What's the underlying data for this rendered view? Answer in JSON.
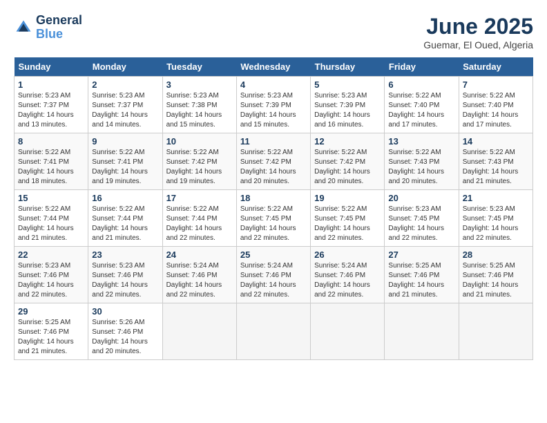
{
  "header": {
    "logo_line1": "General",
    "logo_line2": "Blue",
    "month": "June 2025",
    "location": "Guemar, El Oued, Algeria"
  },
  "days_of_week": [
    "Sunday",
    "Monday",
    "Tuesday",
    "Wednesday",
    "Thursday",
    "Friday",
    "Saturday"
  ],
  "weeks": [
    [
      {
        "day": "1",
        "info": "Sunrise: 5:23 AM\nSunset: 7:37 PM\nDaylight: 14 hours\nand 13 minutes."
      },
      {
        "day": "2",
        "info": "Sunrise: 5:23 AM\nSunset: 7:37 PM\nDaylight: 14 hours\nand 14 minutes."
      },
      {
        "day": "3",
        "info": "Sunrise: 5:23 AM\nSunset: 7:38 PM\nDaylight: 14 hours\nand 15 minutes."
      },
      {
        "day": "4",
        "info": "Sunrise: 5:23 AM\nSunset: 7:39 PM\nDaylight: 14 hours\nand 15 minutes."
      },
      {
        "day": "5",
        "info": "Sunrise: 5:23 AM\nSunset: 7:39 PM\nDaylight: 14 hours\nand 16 minutes."
      },
      {
        "day": "6",
        "info": "Sunrise: 5:22 AM\nSunset: 7:40 PM\nDaylight: 14 hours\nand 17 minutes."
      },
      {
        "day": "7",
        "info": "Sunrise: 5:22 AM\nSunset: 7:40 PM\nDaylight: 14 hours\nand 17 minutes."
      }
    ],
    [
      {
        "day": "8",
        "info": "Sunrise: 5:22 AM\nSunset: 7:41 PM\nDaylight: 14 hours\nand 18 minutes."
      },
      {
        "day": "9",
        "info": "Sunrise: 5:22 AM\nSunset: 7:41 PM\nDaylight: 14 hours\nand 19 minutes."
      },
      {
        "day": "10",
        "info": "Sunrise: 5:22 AM\nSunset: 7:42 PM\nDaylight: 14 hours\nand 19 minutes."
      },
      {
        "day": "11",
        "info": "Sunrise: 5:22 AM\nSunset: 7:42 PM\nDaylight: 14 hours\nand 20 minutes."
      },
      {
        "day": "12",
        "info": "Sunrise: 5:22 AM\nSunset: 7:42 PM\nDaylight: 14 hours\nand 20 minutes."
      },
      {
        "day": "13",
        "info": "Sunrise: 5:22 AM\nSunset: 7:43 PM\nDaylight: 14 hours\nand 20 minutes."
      },
      {
        "day": "14",
        "info": "Sunrise: 5:22 AM\nSunset: 7:43 PM\nDaylight: 14 hours\nand 21 minutes."
      }
    ],
    [
      {
        "day": "15",
        "info": "Sunrise: 5:22 AM\nSunset: 7:44 PM\nDaylight: 14 hours\nand 21 minutes."
      },
      {
        "day": "16",
        "info": "Sunrise: 5:22 AM\nSunset: 7:44 PM\nDaylight: 14 hours\nand 21 minutes."
      },
      {
        "day": "17",
        "info": "Sunrise: 5:22 AM\nSunset: 7:44 PM\nDaylight: 14 hours\nand 22 minutes."
      },
      {
        "day": "18",
        "info": "Sunrise: 5:22 AM\nSunset: 7:45 PM\nDaylight: 14 hours\nand 22 minutes."
      },
      {
        "day": "19",
        "info": "Sunrise: 5:22 AM\nSunset: 7:45 PM\nDaylight: 14 hours\nand 22 minutes."
      },
      {
        "day": "20",
        "info": "Sunrise: 5:23 AM\nSunset: 7:45 PM\nDaylight: 14 hours\nand 22 minutes."
      },
      {
        "day": "21",
        "info": "Sunrise: 5:23 AM\nSunset: 7:45 PM\nDaylight: 14 hours\nand 22 minutes."
      }
    ],
    [
      {
        "day": "22",
        "info": "Sunrise: 5:23 AM\nSunset: 7:46 PM\nDaylight: 14 hours\nand 22 minutes."
      },
      {
        "day": "23",
        "info": "Sunrise: 5:23 AM\nSunset: 7:46 PM\nDaylight: 14 hours\nand 22 minutes."
      },
      {
        "day": "24",
        "info": "Sunrise: 5:24 AM\nSunset: 7:46 PM\nDaylight: 14 hours\nand 22 minutes."
      },
      {
        "day": "25",
        "info": "Sunrise: 5:24 AM\nSunset: 7:46 PM\nDaylight: 14 hours\nand 22 minutes."
      },
      {
        "day": "26",
        "info": "Sunrise: 5:24 AM\nSunset: 7:46 PM\nDaylight: 14 hours\nand 22 minutes."
      },
      {
        "day": "27",
        "info": "Sunrise: 5:25 AM\nSunset: 7:46 PM\nDaylight: 14 hours\nand 21 minutes."
      },
      {
        "day": "28",
        "info": "Sunrise: 5:25 AM\nSunset: 7:46 PM\nDaylight: 14 hours\nand 21 minutes."
      }
    ],
    [
      {
        "day": "29",
        "info": "Sunrise: 5:25 AM\nSunset: 7:46 PM\nDaylight: 14 hours\nand 21 minutes."
      },
      {
        "day": "30",
        "info": "Sunrise: 5:26 AM\nSunset: 7:46 PM\nDaylight: 14 hours\nand 20 minutes."
      },
      null,
      null,
      null,
      null,
      null
    ]
  ]
}
